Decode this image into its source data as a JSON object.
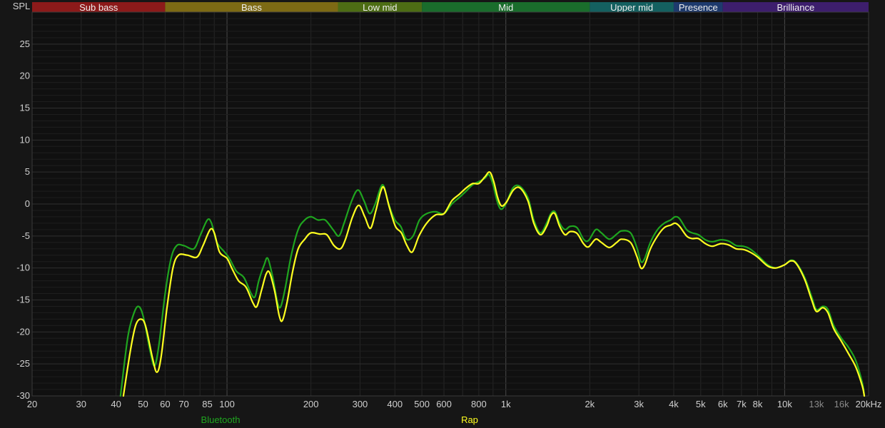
{
  "chart_data": {
    "type": "line",
    "ylabel": "SPL",
    "xscale": "log",
    "xlim": [
      20,
      20000
    ],
    "ylim": [
      -30,
      30
    ],
    "grid": true,
    "colors": {
      "background": "#161616",
      "plot_background": "#101010"
    },
    "x_ticks": [
      {
        "value": 20,
        "label": "20"
      },
      {
        "value": 30,
        "label": "30"
      },
      {
        "value": 40,
        "label": "40"
      },
      {
        "value": 50,
        "label": "50"
      },
      {
        "value": 60,
        "label": "60"
      },
      {
        "value": 70,
        "label": "70"
      },
      {
        "value": 85,
        "label": "85"
      },
      {
        "value": 100,
        "label": "100"
      },
      {
        "value": 200,
        "label": "200"
      },
      {
        "value": 300,
        "label": "300"
      },
      {
        "value": 400,
        "label": "400"
      },
      {
        "value": 500,
        "label": "500"
      },
      {
        "value": 600,
        "label": "600"
      },
      {
        "value": 800,
        "label": "800"
      },
      {
        "value": 1000,
        "label": "1k"
      },
      {
        "value": 2000,
        "label": "2k"
      },
      {
        "value": 3000,
        "label": "3k"
      },
      {
        "value": 4000,
        "label": "4k"
      },
      {
        "value": 5000,
        "label": "5k"
      },
      {
        "value": 6000,
        "label": "6k"
      },
      {
        "value": 7000,
        "label": "7k"
      },
      {
        "value": 8000,
        "label": "8k"
      },
      {
        "value": 10000,
        "label": "10k"
      },
      {
        "value": 13000,
        "label": "13k",
        "dim": true
      },
      {
        "value": 16000,
        "label": "16k",
        "dim": true
      },
      {
        "value": 20000,
        "label": "20kHz"
      }
    ],
    "y_ticks": [
      25,
      20,
      15,
      10,
      5,
      0,
      -5,
      -10,
      -15,
      -20,
      -25,
      -30
    ],
    "bands": [
      {
        "name": "Sub bass",
        "from": 20,
        "to": 60,
        "color": "#8c1a1a"
      },
      {
        "name": "Bass",
        "from": 60,
        "to": 250,
        "color": "#7d6a14"
      },
      {
        "name": "Low mid",
        "from": 250,
        "to": 500,
        "color": "#4d6d14"
      },
      {
        "name": "Mid",
        "from": 500,
        "to": 2000,
        "color": "#1a6d2c"
      },
      {
        "name": "Upper mid",
        "from": 2000,
        "to": 4000,
        "color": "#146060"
      },
      {
        "name": "Presence",
        "from": 4000,
        "to": 6000,
        "color": "#1e3a6d"
      },
      {
        "name": "Brilliance",
        "from": 6000,
        "to": 20000,
        "color": "#3d1e6d"
      }
    ],
    "series": [
      {
        "name": "Bluetooth",
        "color": "#1fa51f",
        "points": [
          [
            41.5,
            -30
          ],
          [
            44,
            -21
          ],
          [
            46,
            -17.5
          ],
          [
            48,
            -16
          ],
          [
            50,
            -17.5
          ],
          [
            53,
            -23
          ],
          [
            55,
            -25.3
          ],
          [
            57,
            -22
          ],
          [
            60,
            -14
          ],
          [
            63,
            -8.5
          ],
          [
            66,
            -6.5
          ],
          [
            70,
            -6.5
          ],
          [
            76,
            -7
          ],
          [
            80,
            -5
          ],
          [
            85,
            -2.5
          ],
          [
            88,
            -3
          ],
          [
            92,
            -6
          ],
          [
            98,
            -7.5
          ],
          [
            102,
            -8.5
          ],
          [
            108,
            -10.5
          ],
          [
            115,
            -11.5
          ],
          [
            122,
            -14
          ],
          [
            126,
            -14.5
          ],
          [
            130,
            -12
          ],
          [
            136,
            -9.5
          ],
          [
            140,
            -8.5
          ],
          [
            146,
            -11.5
          ],
          [
            152,
            -15.5
          ],
          [
            156,
            -16
          ],
          [
            162,
            -13
          ],
          [
            170,
            -8
          ],
          [
            180,
            -4
          ],
          [
            190,
            -2.5
          ],
          [
            200,
            -2
          ],
          [
            212,
            -2.5
          ],
          [
            225,
            -2.5
          ],
          [
            240,
            -4
          ],
          [
            252,
            -5
          ],
          [
            263,
            -3
          ],
          [
            280,
            0.5
          ],
          [
            295,
            2.2
          ],
          [
            310,
            0.5
          ],
          [
            325,
            -1.5
          ],
          [
            340,
            0
          ],
          [
            355,
            2.5
          ],
          [
            365,
            2.8
          ],
          [
            380,
            0
          ],
          [
            400,
            -2.5
          ],
          [
            420,
            -3.5
          ],
          [
            440,
            -5.5
          ],
          [
            465,
            -5
          ],
          [
            490,
            -2.5
          ],
          [
            520,
            -1.5
          ],
          [
            560,
            -1.2
          ],
          [
            600,
            -1.5
          ],
          [
            640,
            0
          ],
          [
            680,
            1
          ],
          [
            720,
            2
          ],
          [
            760,
            3
          ],
          [
            800,
            3.5
          ],
          [
            840,
            4
          ],
          [
            870,
            4.6
          ],
          [
            900,
            3
          ],
          [
            930,
            0.5
          ],
          [
            960,
            -0.8
          ],
          [
            1000,
            0
          ],
          [
            1060,
            2.5
          ],
          [
            1120,
            2.8
          ],
          [
            1200,
            1
          ],
          [
            1260,
            -2.5
          ],
          [
            1330,
            -4.5
          ],
          [
            1400,
            -3
          ],
          [
            1450,
            -1.5
          ],
          [
            1500,
            -1.2
          ],
          [
            1560,
            -3
          ],
          [
            1630,
            -4
          ],
          [
            1700,
            -3.5
          ],
          [
            1800,
            -3.7
          ],
          [
            1900,
            -5.5
          ],
          [
            1980,
            -5.7
          ],
          [
            2100,
            -4
          ],
          [
            2200,
            -4.5
          ],
          [
            2350,
            -5.5
          ],
          [
            2500,
            -4.7
          ],
          [
            2600,
            -4.2
          ],
          [
            2800,
            -4.5
          ],
          [
            2950,
            -6.8
          ],
          [
            3050,
            -9
          ],
          [
            3150,
            -8.5
          ],
          [
            3300,
            -6
          ],
          [
            3500,
            -4
          ],
          [
            3700,
            -3
          ],
          [
            3900,
            -2.5
          ],
          [
            4050,
            -2
          ],
          [
            4200,
            -2.3
          ],
          [
            4450,
            -4
          ],
          [
            4650,
            -4.5
          ],
          [
            4900,
            -4.8
          ],
          [
            5200,
            -5.6
          ],
          [
            5500,
            -5.9
          ],
          [
            5900,
            -5.6
          ],
          [
            6300,
            -5.8
          ],
          [
            6700,
            -6.5
          ],
          [
            7100,
            -6.6
          ],
          [
            7500,
            -7
          ],
          [
            8000,
            -8
          ],
          [
            8700,
            -9.5
          ],
          [
            9300,
            -10
          ],
          [
            10000,
            -9.5
          ],
          [
            10500,
            -8.8
          ],
          [
            11000,
            -9.2
          ],
          [
            11800,
            -11.5
          ],
          [
            12500,
            -14.5
          ],
          [
            13000,
            -16.5
          ],
          [
            13700,
            -16
          ],
          [
            14300,
            -16.5
          ],
          [
            15000,
            -19
          ],
          [
            16000,
            -21
          ],
          [
            17000,
            -22.5
          ],
          [
            18000,
            -24.5
          ],
          [
            19000,
            -28
          ],
          [
            19300,
            -30
          ]
        ]
      },
      {
        "name": "Rap",
        "color": "#ffff20",
        "points": [
          [
            42.5,
            -30
          ],
          [
            45,
            -23
          ],
          [
            47,
            -19
          ],
          [
            49,
            -18
          ],
          [
            51,
            -19
          ],
          [
            54,
            -24
          ],
          [
            56,
            -26.3
          ],
          [
            58,
            -24
          ],
          [
            61,
            -16
          ],
          [
            64,
            -10
          ],
          [
            67,
            -8
          ],
          [
            72,
            -8
          ],
          [
            78,
            -8.3
          ],
          [
            82,
            -6.5
          ],
          [
            87,
            -4
          ],
          [
            90,
            -4.5
          ],
          [
            94,
            -7.5
          ],
          [
            100,
            -8.5
          ],
          [
            104,
            -10
          ],
          [
            110,
            -12
          ],
          [
            117,
            -13
          ],
          [
            124,
            -15.5
          ],
          [
            128,
            -16
          ],
          [
            133,
            -13.5
          ],
          [
            138,
            -11
          ],
          [
            142,
            -10.7
          ],
          [
            148,
            -13.5
          ],
          [
            154,
            -17.5
          ],
          [
            158,
            -18.2
          ],
          [
            164,
            -15.5
          ],
          [
            172,
            -10.5
          ],
          [
            180,
            -7
          ],
          [
            190,
            -5.5
          ],
          [
            200,
            -4.5
          ],
          [
            215,
            -4.7
          ],
          [
            228,
            -4.8
          ],
          [
            242,
            -6.5
          ],
          [
            255,
            -7
          ],
          [
            266,
            -5.5
          ],
          [
            282,
            -2
          ],
          [
            297,
            -0.2
          ],
          [
            312,
            -2
          ],
          [
            327,
            -3.8
          ],
          [
            342,
            -1
          ],
          [
            356,
            2
          ],
          [
            366,
            2.5
          ],
          [
            382,
            -0.5
          ],
          [
            402,
            -3.5
          ],
          [
            422,
            -4.5
          ],
          [
            442,
            -6.5
          ],
          [
            462,
            -7.5
          ],
          [
            488,
            -5
          ],
          [
            520,
            -3
          ],
          [
            560,
            -1.7
          ],
          [
            600,
            -1.5
          ],
          [
            640,
            0.5
          ],
          [
            680,
            1.5
          ],
          [
            720,
            2.5
          ],
          [
            760,
            3.2
          ],
          [
            800,
            3.2
          ],
          [
            840,
            4.2
          ],
          [
            875,
            5
          ],
          [
            905,
            3.5
          ],
          [
            935,
            1
          ],
          [
            965,
            -0.3
          ],
          [
            1005,
            0.3
          ],
          [
            1065,
            2.2
          ],
          [
            1125,
            2.5
          ],
          [
            1200,
            0.5
          ],
          [
            1260,
            -3
          ],
          [
            1330,
            -4.8
          ],
          [
            1400,
            -3.5
          ],
          [
            1450,
            -1.8
          ],
          [
            1500,
            -1.5
          ],
          [
            1560,
            -3.5
          ],
          [
            1630,
            -4.8
          ],
          [
            1700,
            -4.3
          ],
          [
            1800,
            -4.6
          ],
          [
            1900,
            -6.2
          ],
          [
            1980,
            -6.7
          ],
          [
            2100,
            -5.5
          ],
          [
            2200,
            -6
          ],
          [
            2350,
            -6.8
          ],
          [
            2500,
            -6
          ],
          [
            2600,
            -5.5
          ],
          [
            2800,
            -6
          ],
          [
            2950,
            -8.2
          ],
          [
            3050,
            -10
          ],
          [
            3150,
            -9.5
          ],
          [
            3300,
            -7
          ],
          [
            3500,
            -5
          ],
          [
            3700,
            -3.7
          ],
          [
            3900,
            -3.3
          ],
          [
            4050,
            -3
          ],
          [
            4200,
            -3.5
          ],
          [
            4450,
            -5
          ],
          [
            4650,
            -5.4
          ],
          [
            4900,
            -5.4
          ],
          [
            5200,
            -6.2
          ],
          [
            5500,
            -6.6
          ],
          [
            5900,
            -6.2
          ],
          [
            6300,
            -6.4
          ],
          [
            6700,
            -7
          ],
          [
            7100,
            -7.1
          ],
          [
            7500,
            -7.5
          ],
          [
            8000,
            -8.3
          ],
          [
            8700,
            -9.7
          ],
          [
            9300,
            -10
          ],
          [
            10000,
            -9.5
          ],
          [
            10500,
            -8.9
          ],
          [
            11000,
            -9.3
          ],
          [
            11800,
            -11.8
          ],
          [
            12500,
            -15
          ],
          [
            13000,
            -16.8
          ],
          [
            13700,
            -16.2
          ],
          [
            14300,
            -17
          ],
          [
            15000,
            -19.5
          ],
          [
            16000,
            -21.5
          ],
          [
            17000,
            -23.5
          ],
          [
            18000,
            -25.5
          ],
          [
            19000,
            -28.5
          ],
          [
            19300,
            -30
          ]
        ]
      }
    ]
  }
}
